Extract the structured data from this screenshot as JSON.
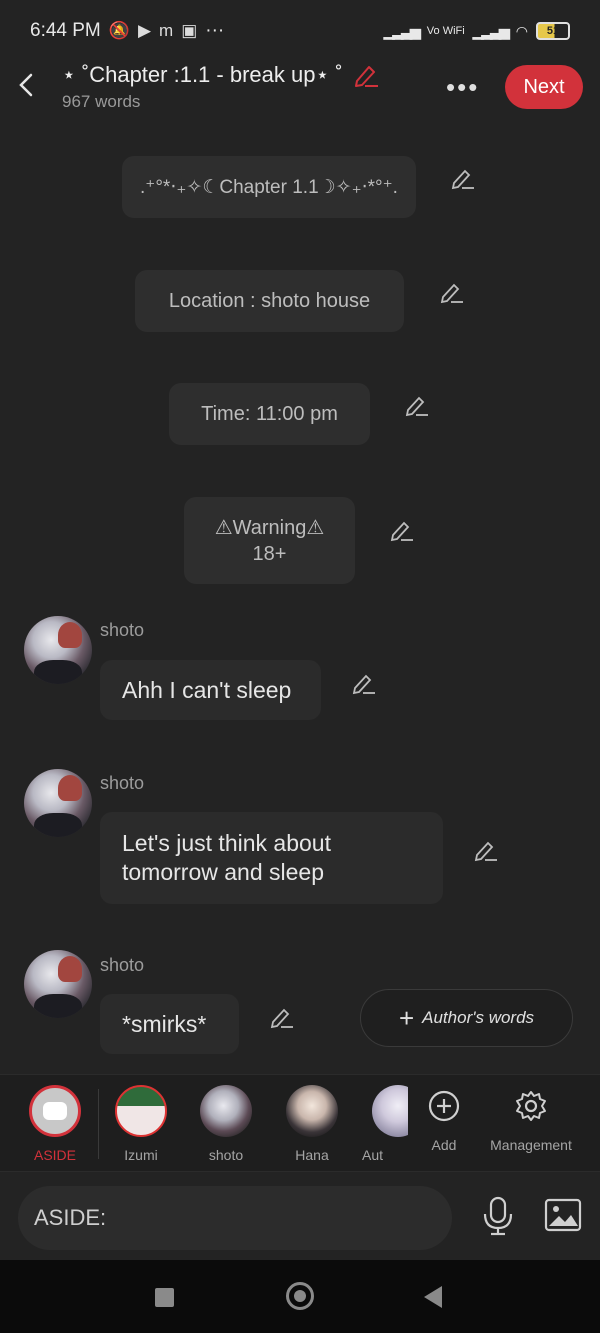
{
  "status_bar": {
    "time": "6:44 PM",
    "left_icons": [
      "mute-bell-icon",
      "youtube-icon",
      "m-app-icon",
      "app-icon"
    ],
    "more": "···",
    "network_label": "Vo WiFi",
    "battery": "51"
  },
  "header": {
    "title": "⋆ ˚Chapter :1.1 - break up⋆ ˚",
    "word_count": "967 words",
    "more_label": "•••",
    "next_label": "Next",
    "accent_color": "#d2323b"
  },
  "narration": [
    {
      "text": ".⁺°*‧₊✧☾Chapter 1.1☽✧₊‧*°⁺."
    },
    {
      "text": "Location : shoto house"
    },
    {
      "text": "Time: 11:00 pm"
    },
    {
      "text": "⚠Warning⚠\n18+"
    }
  ],
  "messages": [
    {
      "character": "shoto",
      "text": "Ahh I can't sleep"
    },
    {
      "character": "shoto",
      "text": "Let's just think about tomorrow and sleep"
    },
    {
      "character": "shoto",
      "text": "*smirks*"
    }
  ],
  "author_words_label": "Author's words",
  "characters": [
    {
      "label": "ASIDE",
      "selected": true
    },
    {
      "label": "Izumi"
    },
    {
      "label": "shoto"
    },
    {
      "label": "Hana"
    },
    {
      "label": "Aut"
    }
  ],
  "tools": {
    "add_label": "Add",
    "management_label": "Management"
  },
  "input": {
    "placeholder": "ASIDE:"
  }
}
